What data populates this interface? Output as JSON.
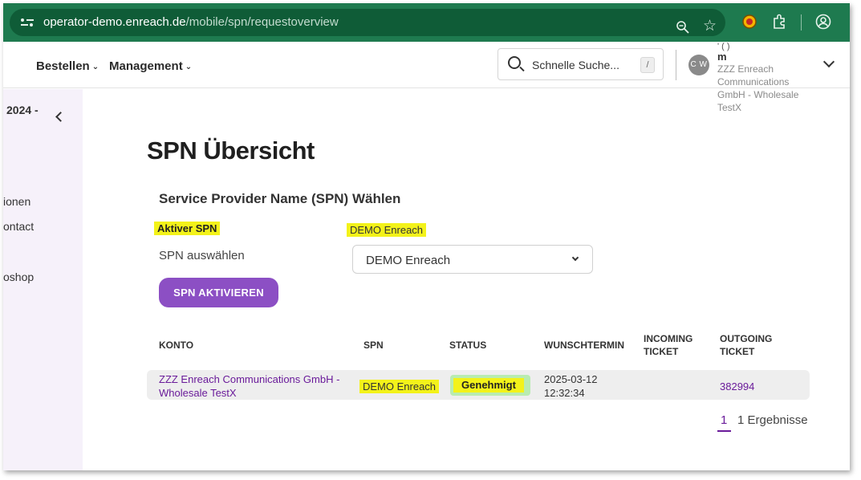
{
  "browser": {
    "url_host": "operator-demo.enreach.de",
    "url_path": "/mobile/spn/requestoverview",
    "icons": [
      "tune-icon",
      "zoom-icon",
      "star-icon",
      "extension-colored-icon",
      "extensions-icon",
      "profile-icon"
    ]
  },
  "header": {
    "menu": [
      {
        "label": "Bestellen"
      },
      {
        "label": "Management"
      }
    ],
    "search_placeholder": "Schnelle Suche...",
    "search_shortcut": "/",
    "avatar_initials": "C W",
    "user_top": "' (      )",
    "user_name": "m",
    "user_org": "ZZZ Enreach Communications GmbH - Wholesale TestX"
  },
  "sidebar": {
    "year_label": "2024 -",
    "items": [
      "ionen",
      "ontact",
      "oshop"
    ]
  },
  "main": {
    "title": "SPN Übersicht",
    "section_title": "Service Provider Name (SPN) Wählen",
    "active_label": "Aktiver SPN",
    "active_value": "DEMO Enreach",
    "select_label": "SPN auswählen",
    "select_value": "DEMO Enreach",
    "activate_button": "SPN AKTIVIEREN"
  },
  "table": {
    "headers": {
      "konto": "KONTO",
      "spn": "SPN",
      "status": "STATUS",
      "wunschtermin": "WUNSCHTERMIN",
      "incoming_1": "INCOMING",
      "incoming_2": "TICKET",
      "outgoing_1": "OUTGOING",
      "outgoing_2": "TICKET"
    },
    "rows": [
      {
        "konto_1": "ZZZ Enreach Communications GmbH -",
        "konto_2": "Wholesale TestX",
        "spn": "DEMO Enreach",
        "status": "Genehmigt",
        "date": "2025-03-12",
        "time": "12:32:34",
        "incoming": "",
        "outgoing": "382994"
      }
    ]
  },
  "pagination": {
    "current": "1",
    "count": "1 Ergebnisse"
  },
  "colors": {
    "browser_green": "#1e7a4f",
    "accent_purple": "#8c4fc4",
    "link_purple": "#6a1b9a",
    "highlight_yellow": "#f3f21a",
    "status_green": "#b9ecb0"
  }
}
